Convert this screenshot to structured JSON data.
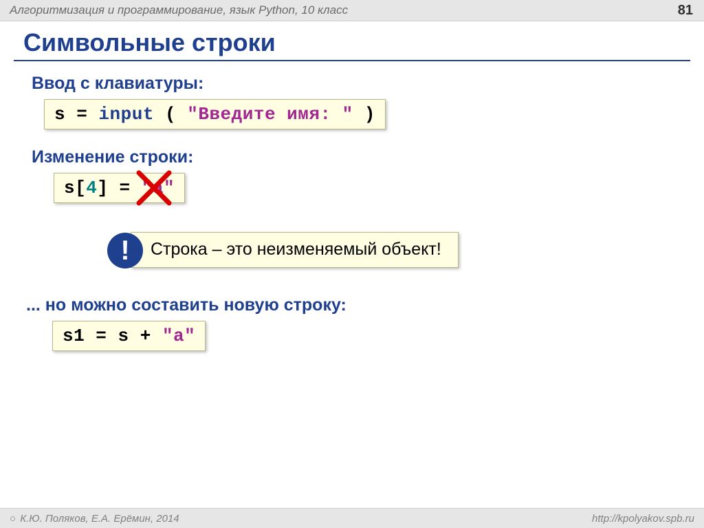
{
  "header": {
    "title": "Алгоритмизация и программирование, язык Python, 10 класс",
    "page_number": "81"
  },
  "title": "Символьные строки",
  "sections": {
    "input": {
      "label": "Ввод с клавиатуры:",
      "code": {
        "pre": "s = ",
        "fn": "input",
        "open": " ( ",
        "literal": "\"Введите имя: \"",
        "close": " )"
      }
    },
    "modify": {
      "label": "Изменение строки:",
      "code": {
        "pre": "s[",
        "idx": "4",
        "mid": "] = ",
        "literal": "\"a\""
      }
    },
    "callout": {
      "icon": "!",
      "text": "Строка – это неизменяемый объект!"
    },
    "compose": {
      "label": "... но можно составить новую строку:",
      "code": {
        "pre": "s1 = s + ",
        "literal": "\"a\""
      }
    }
  },
  "footer": {
    "left": "К.Ю. Поляков, Е.А. Ерёмин, 2014",
    "right": "http://kpolyakov.spb.ru"
  }
}
